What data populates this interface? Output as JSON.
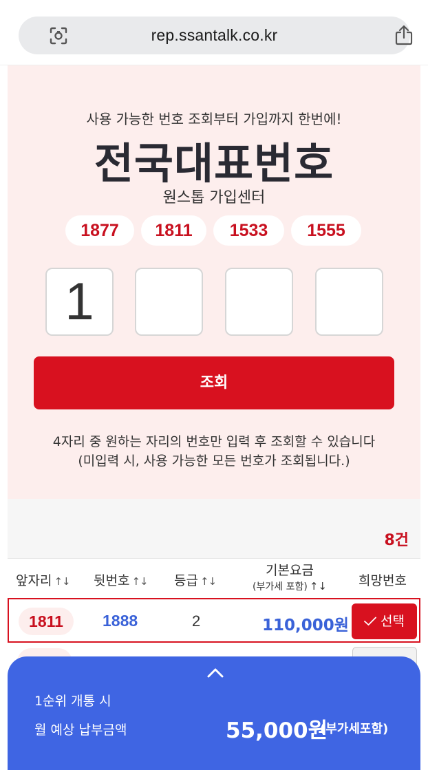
{
  "browser": {
    "url": "rep.ssantalk.co.kr"
  },
  "hero": {
    "subtitle": "사용 가능한 번호 조회부터 가입까지 한번에!",
    "title": "전국대표번호",
    "center_name": "원스톱 가입센터",
    "prefixes": [
      "1877",
      "1811",
      "1533",
      "1555"
    ],
    "digits": [
      "1",
      "",
      "",
      ""
    ],
    "search_label": "조회",
    "hint_line1": "4자리 중 원하는 자리의 번호만 입력 후 조회할 수 있습니다",
    "hint_line2": "(미입력 시, 사용 가능한 모든 번호가 조회됩니다.)"
  },
  "results": {
    "count": "8건",
    "columns": {
      "prefix": "앞자리",
      "suffix": "뒷번호",
      "grade": "등급",
      "fee": "기본요금",
      "fee_note": "(부가세 포함)",
      "wish": "희망번호"
    },
    "sort_glyph": "↑↓",
    "rows": [
      {
        "prefix": "1811",
        "suffix": "1888",
        "grade": "2",
        "fee": "110,000원",
        "select_label": "선택",
        "selected": true
      }
    ]
  },
  "sheet": {
    "line1": "1순위 개통 시",
    "line2": "월 예상 납부금액",
    "amount": "55,000원",
    "vat_note": "(부가세포함)"
  },
  "colors": {
    "brand_red": "#d8111f",
    "hero_bg": "#fdeeed",
    "accent_blue": "#3f65e3",
    "value_blue": "#3a62d8"
  }
}
